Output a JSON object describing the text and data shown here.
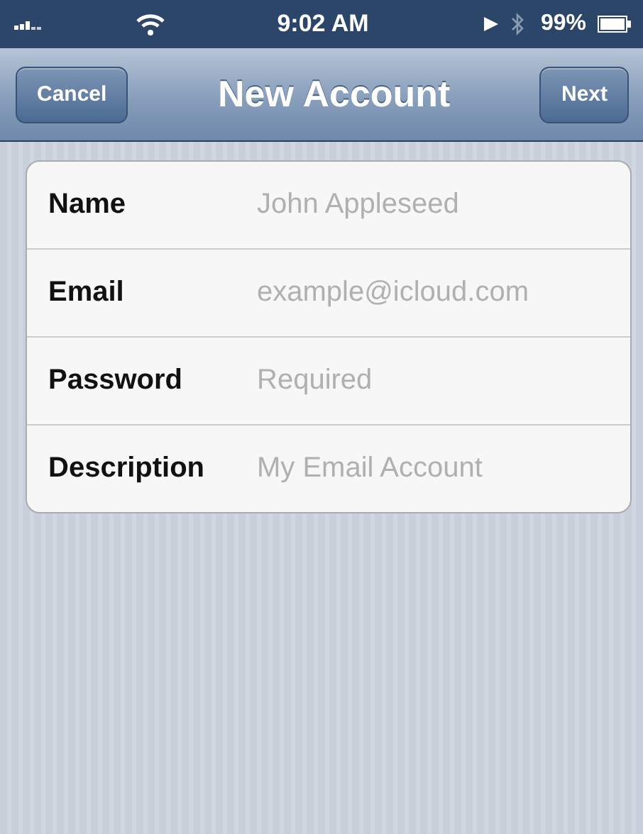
{
  "status_bar": {
    "time": "9:02 AM",
    "battery": "99%"
  },
  "nav_bar": {
    "title": "New Account",
    "left_button": "Cancel",
    "right_button": "Next"
  },
  "form": {
    "fields": [
      {
        "label": "Name",
        "placeholder": "John Appleseed"
      },
      {
        "label": "Email",
        "placeholder": "example@icloud.com"
      },
      {
        "label": "Password",
        "placeholder": "Required"
      },
      {
        "label": "Description",
        "placeholder": "My Email Account"
      }
    ]
  }
}
